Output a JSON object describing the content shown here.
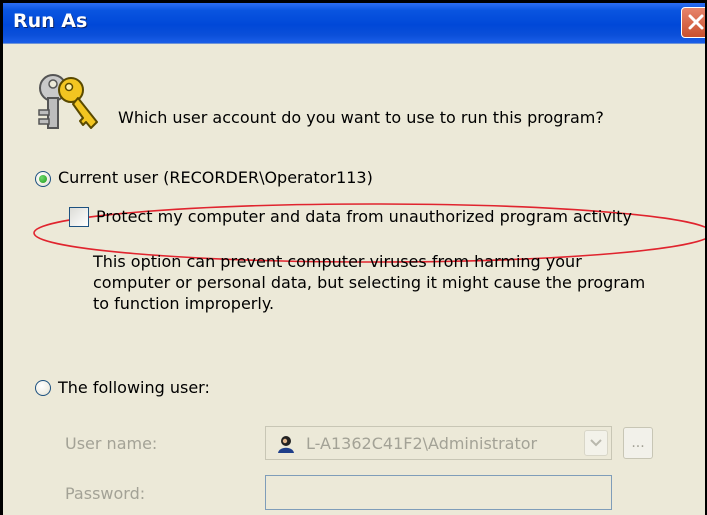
{
  "window": {
    "title": "Run As"
  },
  "prompt": {
    "question": "Which user account do you want to use to run this program?"
  },
  "current_user": {
    "label": "Current user (RECORDER\\Operator113)",
    "selected": true
  },
  "protect": {
    "label": "Protect my computer and data from unauthorized program activity",
    "checked": false,
    "highlight_color": "#e0242e"
  },
  "description": {
    "line1": "This option can prevent computer viruses from harming your",
    "line2": "computer or personal data, but selecting it might cause the program",
    "line3": "to function improperly."
  },
  "following_user": {
    "label": "The following user:",
    "selected": false
  },
  "form": {
    "username_label": "User name:",
    "username_value": "L-A1362C41F2\\Administrator",
    "browse_label": "...",
    "password_label": "Password:",
    "password_value": ""
  },
  "icons": {
    "dialog": "keys-icon",
    "close": "close-icon",
    "user": "user-icon",
    "dropdown": "chevron-down-icon"
  },
  "colors": {
    "titlebar": "#0048d8",
    "dialog_bg": "#ece9d8",
    "disabled_text": "#a3a296",
    "radio_dot": "#1f9d1d"
  }
}
